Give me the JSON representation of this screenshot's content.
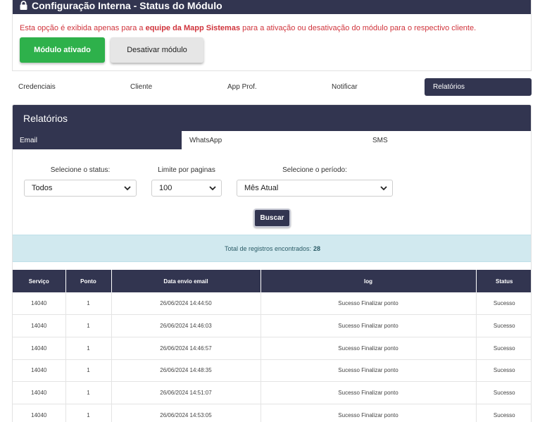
{
  "config": {
    "title": "Configuração Interna - Status do Módulo",
    "message_pre": "Esta opção é exibida apenas para a ",
    "message_bold": "equipe da Mapp Sistemas",
    "message_post": " para a ativação ou desativação do módulo para o respectivo cliente.",
    "btn_activated": "Módulo ativado",
    "btn_deactivate": "Desativar módulo"
  },
  "main_tabs": [
    {
      "label": "Credenciais"
    },
    {
      "label": "Cliente"
    },
    {
      "label": "App Prof."
    },
    {
      "label": "Notificar"
    },
    {
      "label": "Relatórios"
    }
  ],
  "reports": {
    "title": "Relatórios",
    "sub_tabs": [
      {
        "label": "Email"
      },
      {
        "label": "WhatsApp"
      },
      {
        "label": "SMS"
      }
    ],
    "filters": {
      "status_label": "Selecione o status:",
      "status_value": "Todos",
      "limit_label": "Limite por paginas",
      "limit_value": "100",
      "period_label": "Selecione o período:",
      "period_value": "Mês Atual"
    },
    "search_btn": "Buscar",
    "total_text": "Total de registros encontrados:",
    "total_count": "28",
    "table": {
      "headers": [
        "Serviço",
        "Ponto",
        "Data envio email",
        "log",
        "Status"
      ],
      "rows": [
        [
          "14040",
          "1",
          "26/06/2024 14:44:50",
          "Sucesso Finalizar ponto",
          "Sucesso"
        ],
        [
          "14040",
          "1",
          "26/06/2024 14:46:03",
          "Sucesso Finalizar ponto",
          "Sucesso"
        ],
        [
          "14040",
          "1",
          "26/06/2024 14:46:57",
          "Sucesso Finalizar ponto",
          "Sucesso"
        ],
        [
          "14040",
          "1",
          "26/06/2024 14:48:35",
          "Sucesso Finalizar ponto",
          "Sucesso"
        ],
        [
          "14040",
          "1",
          "26/06/2024 14:51:07",
          "Sucesso Finalizar ponto",
          "Sucesso"
        ],
        [
          "14040",
          "1",
          "26/06/2024 14:53:05",
          "Sucesso Finalizar ponto",
          "Sucesso"
        ]
      ]
    }
  },
  "colors": {
    "navy": "#323550",
    "green": "#2eb14b",
    "alert_red": "#d0343c",
    "info_bg": "#d1e9ef"
  },
  "icons": {
    "header": "lock-icon",
    "select": "chevron-down-icon"
  }
}
